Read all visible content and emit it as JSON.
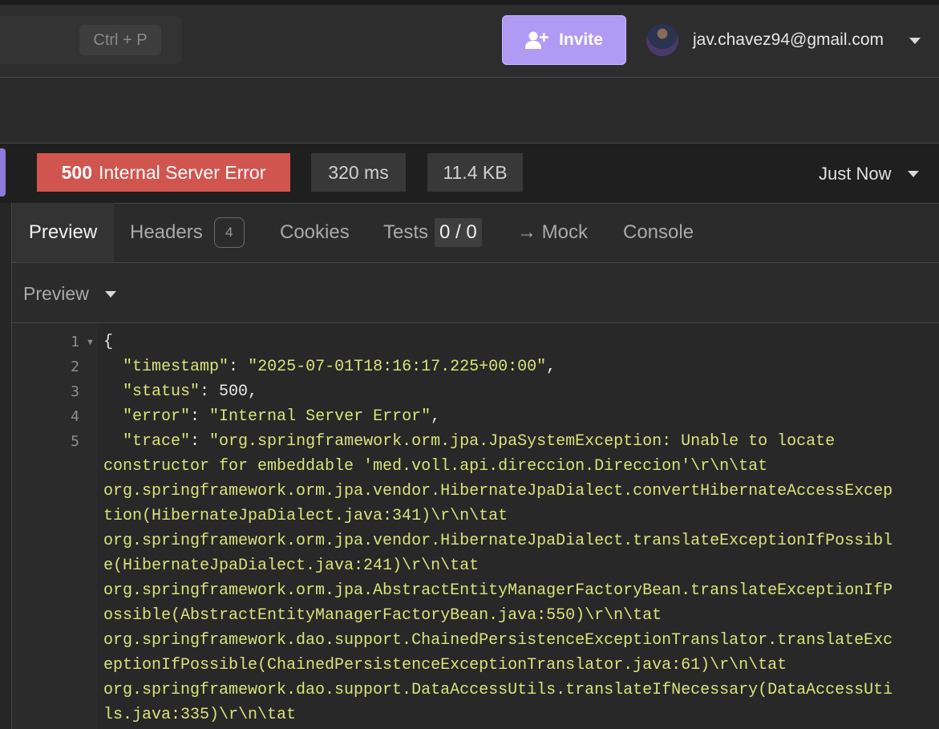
{
  "search": {
    "shortcut": "Ctrl + P"
  },
  "header": {
    "invite_label": "Invite",
    "user_email": "jav.chavez94@gmail.com"
  },
  "response": {
    "status_code": "500",
    "status_text": "Internal Server Error",
    "time": "320 ms",
    "size": "11.4 KB",
    "timestamp_label": "Just Now"
  },
  "tabs": [
    {
      "label": "Preview",
      "active": true
    },
    {
      "label": "Headers",
      "badge": "4"
    },
    {
      "label": "Cookies"
    },
    {
      "label": "Tests",
      "badge": "0 / 0"
    },
    {
      "label": "→ Mock"
    },
    {
      "label": "Console"
    }
  ],
  "preview_mode": "Preview",
  "code": {
    "line_numbers": [
      "1",
      "2",
      "3",
      "4",
      "5"
    ],
    "open_brace": "{",
    "timestamp_key": "\"timestamp\"",
    "timestamp_value": "\"2025-07-01T18:16:17.225+00:00\"",
    "status_key": "\"status\"",
    "status_value": "500",
    "error_key": "\"error\"",
    "error_value": "\"Internal Server Error\"",
    "trace_key": "\"trace\"",
    "trace_lines": [
      "\"org.springframework.orm.jpa.JpaSystemException: Unable to locate",
      "constructor for embeddable 'med.voll.api.direccion.Direccion'\\r\\n\\tat",
      "org.springframework.orm.jpa.vendor.HibernateJpaDialect.convertHibernateAccessExcep",
      "tion(HibernateJpaDialect.java:341)\\r\\n\\tat",
      "org.springframework.orm.jpa.vendor.HibernateJpaDialect.translateExceptionIfPossibl",
      "e(HibernateJpaDialect.java:241)\\r\\n\\tat",
      "org.springframework.orm.jpa.AbstractEntityManagerFactoryBean.translateExceptionIfP",
      "ossible(AbstractEntityManagerFactoryBean.java:550)\\r\\n\\tat",
      "org.springframework.dao.support.ChainedPersistenceExceptionTranslator.translateExc",
      "eptionIfPossible(ChainedPersistenceExceptionTranslator.java:61)\\r\\n\\tat",
      "org.springframework.dao.support.DataAccessUtils.translateIfNecessary(DataAccessUti",
      "ls.java:335)\\r\\n\\tat"
    ]
  },
  "colors": {
    "accent": "#b19af4",
    "error_status": "#d0554f",
    "json_string": "#d8e37a"
  }
}
